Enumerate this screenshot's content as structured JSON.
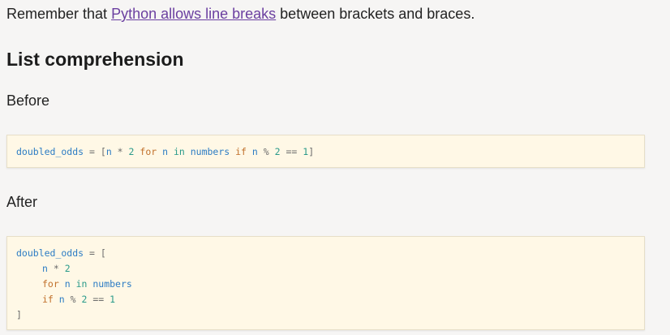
{
  "intro": {
    "before_link": "Remember that ",
    "link_text": "Python allows line breaks",
    "after_link": " between brackets and braces."
  },
  "section": {
    "title": "List comprehension"
  },
  "before": {
    "label": "Before",
    "code": {
      "var": "doubled_odds",
      "assign": " = ",
      "open": "[",
      "n1": "n",
      "mul": " * ",
      "two1": "2",
      "for": " for ",
      "n2": "n",
      "in": " in ",
      "numbers": "numbers",
      "if": " if ",
      "n3": "n",
      "mod": " % ",
      "two2": "2",
      "eq": " == ",
      "one": "1",
      "close": "]"
    }
  },
  "after": {
    "label": "After",
    "code": {
      "l1_var": "doubled_odds",
      "l1_assign": " = ",
      "l1_open": "[",
      "l2_n": "n",
      "l2_mul": " * ",
      "l2_two": "2",
      "l3_for": "for",
      "l3_n": " n ",
      "l3_in": "in",
      "l3_numbers": " numbers",
      "l4_if": "if",
      "l4_n": " n ",
      "l4_mod": "% ",
      "l4_two": "2",
      "l4_eq": " == ",
      "l4_one": "1",
      "l5_close": "]"
    }
  }
}
